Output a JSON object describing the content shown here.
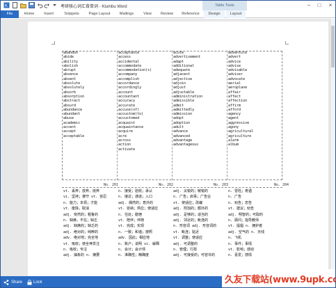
{
  "app": {
    "title": "考研核心词汇背单词 - Klumbu Word",
    "table_tools": "Table Tools",
    "min": "−",
    "max": "□",
    "close": "×"
  },
  "ribbon": {
    "tabs": [
      "File",
      "Home",
      "Insert",
      "Snippets",
      "Page Layout",
      "Mailings",
      "View",
      "Review",
      "Reference",
      "Design",
      "Layout"
    ]
  },
  "pages": {
    "top": {
      "col1": [
        "abandon",
        "abide",
        "ability",
        "abolish",
        "abrupt",
        "absence",
        "absent",
        "absolute",
        "absolutely",
        "absorb",
        "absorption",
        "abstract",
        "absurd",
        "abundance",
        "abundant",
        "abuse",
        "academic",
        "accent",
        "accept",
        "acceptable"
      ],
      "col2": [
        "acceptance",
        "access",
        "accidental",
        "accommodate",
        "accommodation(s)",
        "accompany",
        "accomplish",
        "accordance",
        "accordingly",
        "account",
        "accountant",
        "accuracy",
        "accurate",
        "accuse(of)",
        "accustom(to)",
        "accustomed",
        "acquaint",
        "acquaintance",
        "acquire",
        "acre",
        "across",
        "action",
        "activate"
      ],
      "col3": [
        "acute",
        "advertisement",
        "adapt",
        "additional",
        "adequate",
        "adjacent",
        "adjective",
        "adjoin",
        "adjust",
        "adjustable",
        "administration",
        "admissible",
        "admit",
        "admittedly",
        "admission",
        "adopt",
        "adoption",
        "adult",
        "advance",
        "advanced",
        "advantage",
        "advantageous"
      ],
      "col4": [
        "adventure",
        "advert",
        "advice",
        "advise",
        "advisable",
        "adviser",
        "advocate",
        "aerial",
        "aeroplane",
        "affair",
        "affect",
        "affection",
        "affirm",
        "afford",
        "agency",
        "agent",
        "aggressive",
        "agony",
        "agricultural",
        "agriculture",
        "alarm",
        "album"
      ]
    },
    "numbers": [
      "No. 201",
      "No. 202",
      "No. 203",
      "No. 204"
    ],
    "bottom": {
      "col1": [
        "vt. 丢弃；放弃，抛弃",
        "vi. 坚持；遵守 vt. 容忍",
        "n. 能力；本领；才能",
        "vt. 废除，取消",
        "adj. 突然的；粗鲁的",
        "n. 缺席，不在；缺乏",
        "adj. 缺席的；缺乏的",
        "adj. 绝对的；纯粹的",
        "adv. 绝对地；完全地",
        "vt. 吸收；使全神贯注",
        "n. 吸收；专注",
        "adj. 抽象的 n. 摘要"
      ],
      "col2": [
        "n. 接受；验收；承认",
        "n. 接近；通道；入口",
        "adj. 偶然的；意外的",
        "vt. 容纳；供应；使适应",
        "n. 住处；膳宿",
        "vt. 陪伴；伴随",
        "vt. 完成；实现",
        "n. 一致；和谐；按照",
        "adv. 因此；相应地",
        "n. 账户；说明 vi. 解释",
        "n. 会计；会计师",
        "n. 准确性；精确度"
      ],
      "col3": [
        "adj. 尖锐的；敏锐的",
        "n. 广告；启事；广告业",
        "vt. 使适应；改编",
        "adj. 附加的；额外的",
        "adj. 足够的；适当的",
        "adj. 邻近的；毗连的",
        "n. 形容词 adj. 形容词的",
        "vt. 毗连；贴近",
        "vt. 调整；使适应",
        "adj. 可调整的",
        "n. 管理；行政",
        "adj. 可接受的；可容许的"
      ],
      "col4": [
        "n. 冒险；奇遇",
        "n. 广告",
        "n. 劝告；忠告",
        "vt. 建议；劝告",
        "adj. 明智的；可取的",
        "n. 顾问；指导教师",
        "vt. 提倡 n. 拥护者",
        "adj. 空气的 n. 天线",
        "n. 飞机",
        "n. 事件；事情",
        "vt. 影响；感动",
        "n. 喜爱；感情"
      ]
    }
  },
  "status": {
    "share": "Share",
    "lock": "Lock"
  },
  "watermark": "久友下载站(www.9upk.com)"
}
